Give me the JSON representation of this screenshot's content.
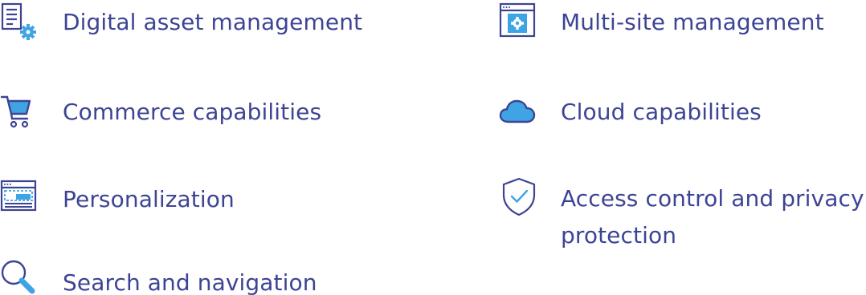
{
  "colors": {
    "text": "#3d4494",
    "primary": "#3d4494",
    "accent": "#3fa4e3"
  },
  "features": {
    "left": [
      {
        "label": "Digital asset management",
        "icon": "document-gear-icon"
      },
      {
        "label": "Commerce capabilities",
        "icon": "shopping-cart-icon"
      },
      {
        "label": "Personalization",
        "icon": "browser-layout-icon"
      },
      {
        "label": "Search and navigation",
        "icon": "search-icon"
      }
    ],
    "right": [
      {
        "label": "Multi-site management",
        "icon": "browser-gear-icon"
      },
      {
        "label": "Cloud capabilities",
        "icon": "cloud-icon"
      },
      {
        "label": "Access control and privacy protection",
        "icon": "shield-check-icon"
      }
    ]
  }
}
